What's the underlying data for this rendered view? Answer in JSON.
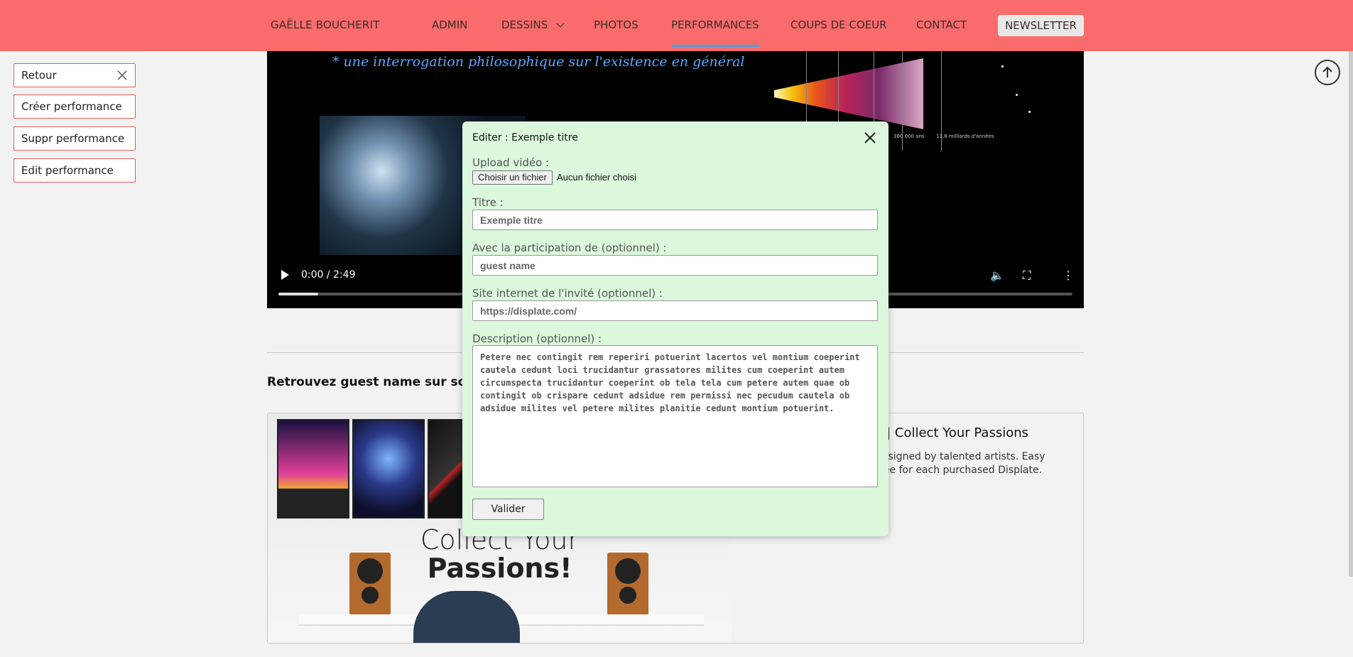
{
  "nav": {
    "brand": "GAËLLE BOUCHERIT",
    "items": [
      {
        "label": "ADMIN"
      },
      {
        "label": "DESSINS"
      },
      {
        "label": "PHOTOS"
      },
      {
        "label": "PERFORMANCES"
      },
      {
        "label": "COUPS DE COEUR"
      },
      {
        "label": "CONTACT"
      }
    ],
    "newsletter": "NEWSLETTER",
    "colors": {
      "bar": "#fa6c6c",
      "active_underline": "#4aa3df"
    }
  },
  "side_buttons": {
    "retour": "Retour",
    "creer": "Créer performance",
    "suppr": "Suppr performance",
    "edit": "Edit performance"
  },
  "video": {
    "handwritten": "* une interrogation philosophique sur l'existence en général",
    "time": "0:00 / 2:49",
    "progress_fraction": 0.05,
    "cosmo_labels": [
      "380 000 ans",
      "13,8 milliards d'années"
    ]
  },
  "promo": {
    "title": "Retrouvez guest name sur son s",
    "card_heading": "s | Collect Your Passions",
    "card_desc": "designed by talented artists. Easy\n tree for each purchased Displate.",
    "image_line1": "Collect Your",
    "image_line2": "Passions!"
  },
  "modal": {
    "title": "Editer : Exemple titre",
    "upload_label": "Upload vidéo :",
    "file_button": "Choisir un fichier",
    "file_none": "Aucun fichier choisi",
    "titre_label": "Titre :",
    "titre_value": "Exemple titre",
    "guest_label": "Avec la participation de (optionnel) :",
    "guest_value": "guest name",
    "site_label": "Site internet de l'invité (optionnel) :",
    "site_value": "https://displate.com/",
    "desc_label": "Description (optionnel) :",
    "desc_value": "Petere nec contingit rem reperiri potuerint lacertos vel montium coeperint cautela cedunt loci trucidantur grassatores milites cum coeperint autem circumspecta trucidantur coeperint ob tela tela cum petere autem quae ob contingit ob crispare cedunt adsidue rem permissi nec pecudum cautela ob adsidue milites vel petere milites planitie cedunt montium potuerint.",
    "submit": "Valider",
    "background": "#dbf7dc"
  }
}
